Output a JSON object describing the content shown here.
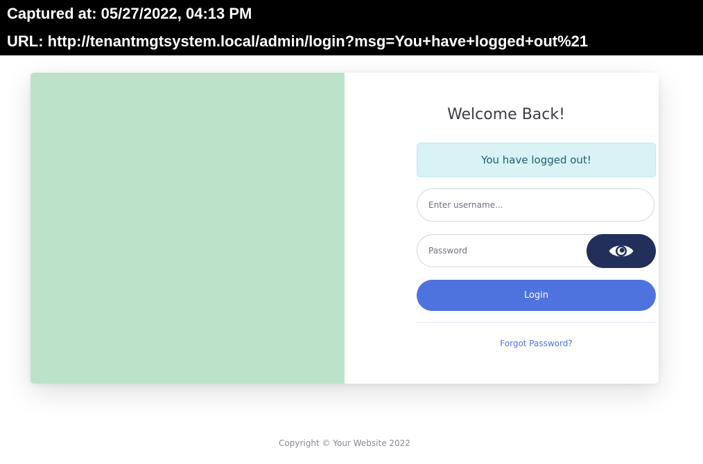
{
  "capture": {
    "captured_at": "Captured at: 05/27/2022, 04:13 PM",
    "url": "URL: http://tenantmgtsystem.local/admin/login?msg=You+have+logged+out%21"
  },
  "login": {
    "heading": "Welcome Back!",
    "alert_message": "You have logged out!",
    "username_placeholder": "Enter username...",
    "username_value": "",
    "password_placeholder": "Password",
    "password_value": "",
    "toggle_password_icon": "eye-icon",
    "login_label": "Login",
    "forgot_password_label": "Forgot Password?"
  },
  "footer": {
    "copyright": "Copyright © Your Website 2022"
  },
  "colors": {
    "capture_bar": "#000000",
    "image_panel": "#bce3c9",
    "alert_background": "#d9f2f6",
    "eye_button": "#212f5a",
    "primary": "#4e73df"
  }
}
